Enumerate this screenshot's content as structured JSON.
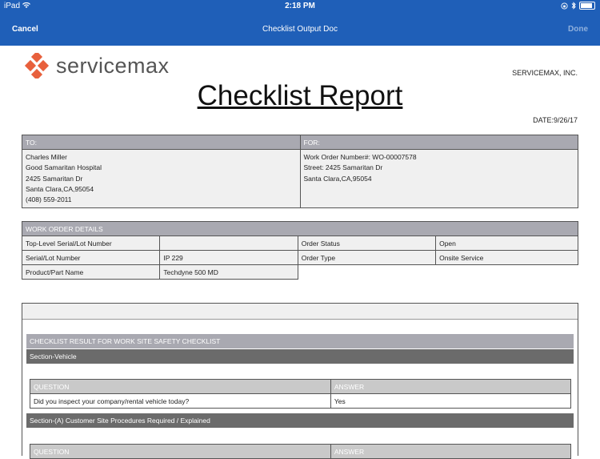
{
  "status_bar": {
    "device": "iPad",
    "time": "2:18 PM"
  },
  "nav": {
    "cancel": "Cancel",
    "title": "Checklist Output Doc",
    "done": "Done"
  },
  "header": {
    "logo_text": "servicemax",
    "company": "SERVICEMAX, INC.",
    "title": "Checklist Report",
    "date": "DATE:9/26/17"
  },
  "to": {
    "label": "TO:",
    "lines": [
      "Charles Miller",
      "Good Samaritan Hospital",
      "2425 Samaritan Dr",
      "Santa Clara,CA,95054",
      "(408) 559-2011"
    ]
  },
  "for": {
    "label": "FOR:",
    "lines": [
      "Work Order Number#: WO-00007578",
      "Street: 2425 Samaritan Dr",
      "Santa Clara,CA,95054"
    ]
  },
  "work_order": {
    "title": "WORK ORDER DETAILS",
    "rows": [
      [
        "Top-Level Serial/Lot Number",
        "",
        "Order Status",
        "Open"
      ],
      [
        "Serial/Lot Number",
        "IP 229",
        "Order Type",
        "Onsite Service"
      ],
      [
        "Product/Part Name",
        "Techdyne 500 MD",
        "",
        ""
      ]
    ]
  },
  "checklist": {
    "title": "CHECKLIST RESULT FOR WORK SITE SAFETY CHECKLIST",
    "sections": [
      {
        "name": "Section-Vehicle",
        "question_header": "QUESTION",
        "answer_header": "ANSWER",
        "rows": [
          {
            "question": "Did you inspect your company/rental vehicle today?",
            "answer": "Yes"
          }
        ]
      },
      {
        "name": "Section-(A) Customer Site Procedures Required / Explained",
        "question_header": "QUESTION",
        "answer_header": "ANSWER"
      }
    ]
  },
  "colors": {
    "nav_blue": "#1f5fb8",
    "header_gray": "#a9a9b1",
    "section_gray": "#6b6b6b",
    "logo_orange": "#e8603c"
  }
}
